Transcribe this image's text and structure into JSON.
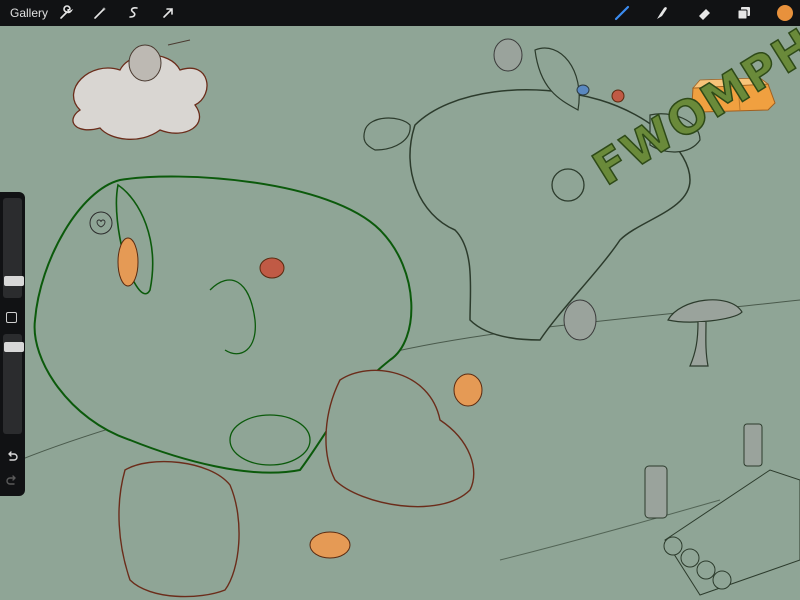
{
  "app": {
    "gallery_label": "Gallery"
  },
  "toolbar": {
    "left_icons": [
      "wrench-icon",
      "magic-wand-icon",
      "selection-icon",
      "transform-arrow-icon"
    ],
    "right_icons": [
      "brush-icon",
      "smudge-icon",
      "eraser-icon",
      "layers-icon"
    ],
    "active_tool": "brush",
    "current_color": "#e8913c"
  },
  "sidebar": {
    "brush_size_level": 0.3,
    "opacity_level": 0.15,
    "icons": [
      "modify-square-icon",
      "undo-icon",
      "redo-icon"
    ]
  },
  "canvas": {
    "background_color": "#8fa596",
    "sound_effect_text": "FWOMPH!"
  }
}
